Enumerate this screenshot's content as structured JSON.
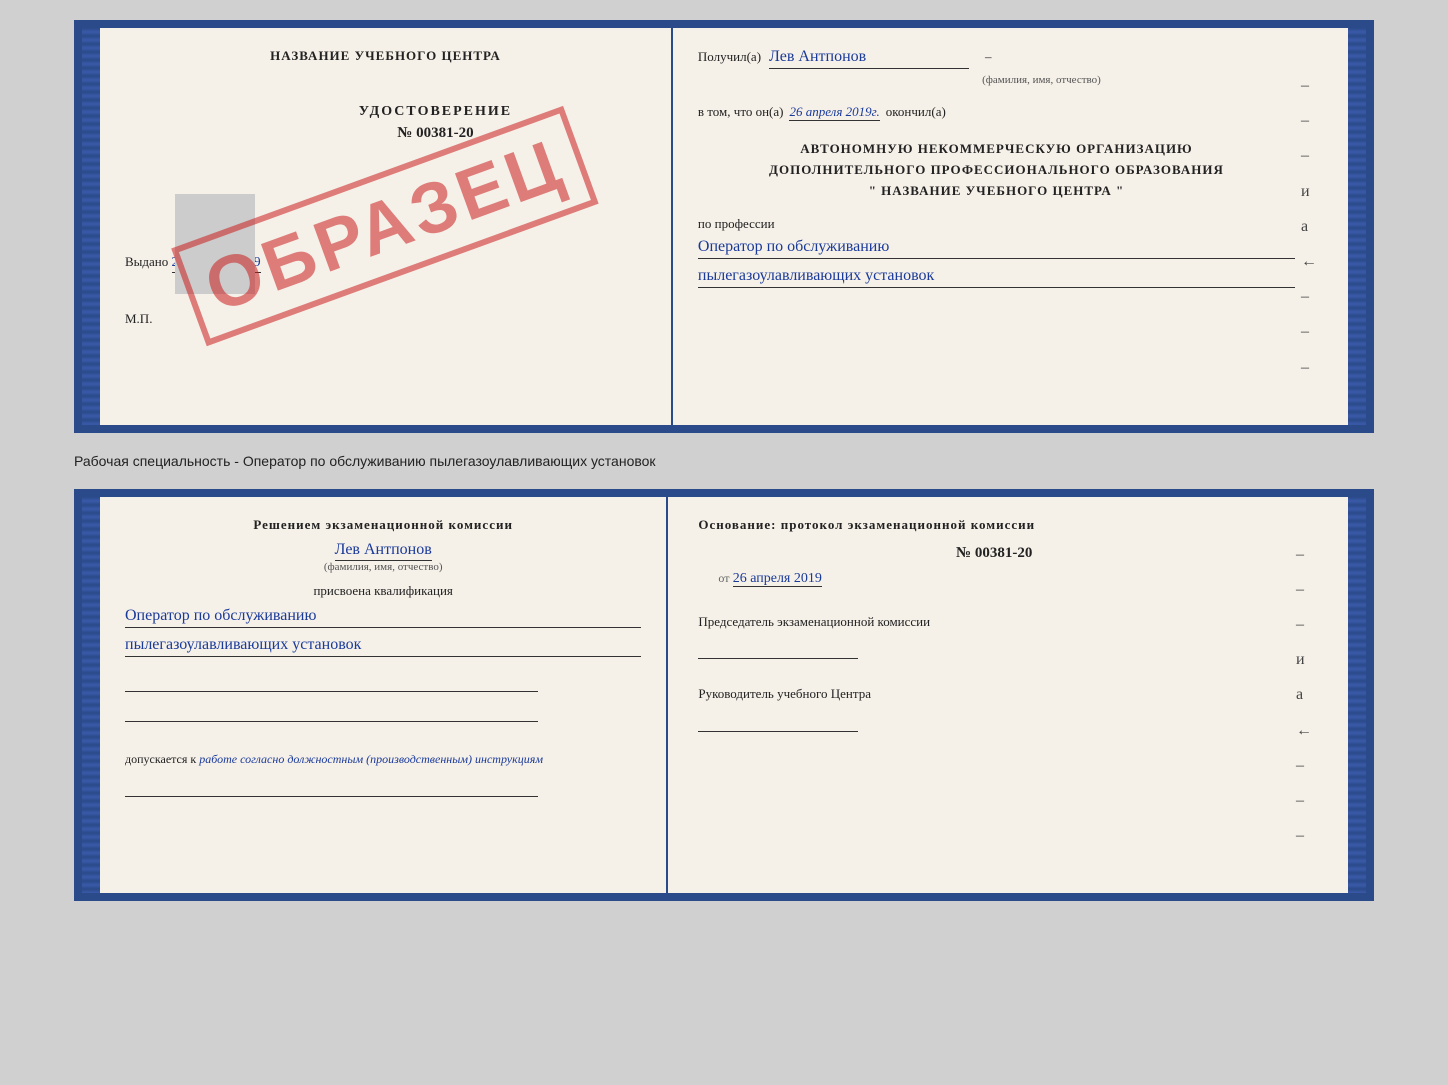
{
  "page": {
    "background": "#d0d0d0"
  },
  "top_certificate": {
    "left_page": {
      "school_name": "НАЗВАНИЕ УЧЕБНОГО ЦЕНТРА",
      "udostoverenie_label": "УДОСТОВЕРЕНИЕ",
      "number": "№ 00381-20",
      "vydano_label": "Выдано",
      "vydano_date": "26 апреля 2019",
      "mp_label": "М.П.",
      "stamp_text": "ОБРАЗЕЦ"
    },
    "right_page": {
      "poluchil_label": "Получил(а)",
      "recipient_name": "Лев Антпонов",
      "fio_sub": "(фамилия, имя, отчество)",
      "vtom_label": "в том, что он(а)",
      "date_value": "26 апреля 2019г.",
      "okonchil_label": "окончил(а)",
      "org_line1": "АВТОНОМНУЮ НЕКОММЕРЧЕСКУЮ ОРГАНИЗАЦИЮ",
      "org_line2": "ДОПОЛНИТЕЛЬНОГО ПРОФЕССИОНАЛЬНОГО ОБРАЗОВАНИЯ",
      "org_line3": "\"  НАЗВАНИЕ УЧЕБНОГО ЦЕНТРА  \"",
      "po_professii_label": "по профессии",
      "profession_line1": "Оператор по обслуживанию",
      "profession_line2": "пылегазоулавливающих установок",
      "dash_items": [
        "-",
        "-",
        "-",
        "и",
        "а",
        "←",
        "-",
        "-",
        "-"
      ]
    }
  },
  "separator": {
    "text": "Рабочая специальность - Оператор по обслуживанию пылегазоулавливающих установок"
  },
  "bottom_certificate": {
    "left_page": {
      "resheniyem_label": "Решением экзаменационной комиссии",
      "recipient_name": "Лев Антпонов",
      "fio_sub": "(фамилия, имя, отчество)",
      "prisvoena_label": "присвоена квалификация",
      "qualification_line1": "Оператор по обслуживанию",
      "qualification_line2": "пылегазоулавливающих установок",
      "dopuskaetsya_label": "допускается к",
      "dopuskaetsya_value": "работе согласно должностным (производственным) инструкциям"
    },
    "right_page": {
      "osnovaniye_label": "Основание: протокол экзаменационной комиссии",
      "protocol_number": "№ 00381-20",
      "ot_label": "от",
      "ot_date": "26 апреля 2019",
      "predsedatel_label": "Председатель экзаменационной комиссии",
      "rukovoditel_label": "Руководитель учебного Центра",
      "dash_items": [
        "-",
        "-",
        "-",
        "и",
        "а",
        "←",
        "-",
        "-",
        "-"
      ]
    }
  }
}
